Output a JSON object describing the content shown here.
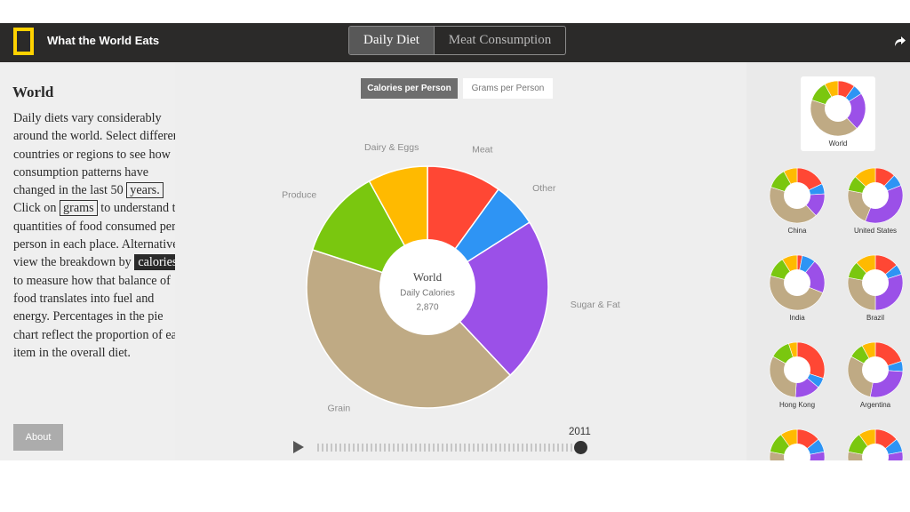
{
  "header": {
    "app_title": "What the World Eats",
    "tabs": [
      {
        "label": "Daily Diet",
        "active": true
      },
      {
        "label": "Meat Consumption",
        "active": false
      }
    ]
  },
  "sidebar": {
    "region_title": "World",
    "description": {
      "p1": "Daily diets vary considerably around the world. Select different countries or regions to see how consumption patterns have changed in the last 50",
      "years_link": "years.",
      "p2": "Click on",
      "grams_link": "grams",
      "p3": "to understand the quantities of food consumed per person in each place. Alternatively, view the breakdown by",
      "calories_link": "calories",
      "p4": "to measure how that balance of food translates into fuel and energy. Percentages in the pie chart reflect the proportion of each item in the overall diet."
    },
    "about_label": "About"
  },
  "metric_toggle": {
    "calories_label": "Calories per Person",
    "grams_label": "Grams per Person",
    "active": "calories"
  },
  "chart": {
    "center_title": "World",
    "center_subtitle": "Daily Calories",
    "center_value": "2,870"
  },
  "chart_data": {
    "type": "pie",
    "categories": [
      "Meat",
      "Other",
      "Sugar & Fat",
      "Grain",
      "Produce",
      "Dairy & Eggs"
    ],
    "values": [
      10,
      6,
      22,
      42,
      12,
      8
    ],
    "colors": [
      "#ff4734",
      "#2e94f4",
      "#9b50e8",
      "#bfaa84",
      "#7ac70f",
      "#ffba00"
    ]
  },
  "timeline": {
    "year": "2011",
    "progress": 1.0
  },
  "regions": [
    {
      "name": "World",
      "selected": true,
      "values": [
        10,
        6,
        22,
        42,
        12,
        8
      ]
    },
    {
      "name": "China",
      "values": [
        18,
        6,
        14,
        42,
        12,
        8
      ]
    },
    {
      "name": "United States",
      "values": [
        12,
        7,
        37,
        22,
        9,
        13
      ]
    },
    {
      "name": "India",
      "values": [
        3,
        8,
        20,
        48,
        12,
        9
      ]
    },
    {
      "name": "Brazil",
      "values": [
        14,
        6,
        30,
        28,
        10,
        12
      ]
    },
    {
      "name": "Hong Kong",
      "values": [
        30,
        6,
        15,
        32,
        12,
        5
      ]
    },
    {
      "name": "Argentina",
      "values": [
        20,
        6,
        27,
        30,
        9,
        8
      ]
    },
    {
      "name": "",
      "values": [
        14,
        8,
        20,
        36,
        12,
        10
      ]
    },
    {
      "name": "",
      "values": [
        14,
        8,
        20,
        36,
        12,
        10
      ]
    }
  ],
  "icons": {
    "logo": "national-geographic-logo",
    "share": "share-arrow-icon",
    "play": "play-icon"
  }
}
